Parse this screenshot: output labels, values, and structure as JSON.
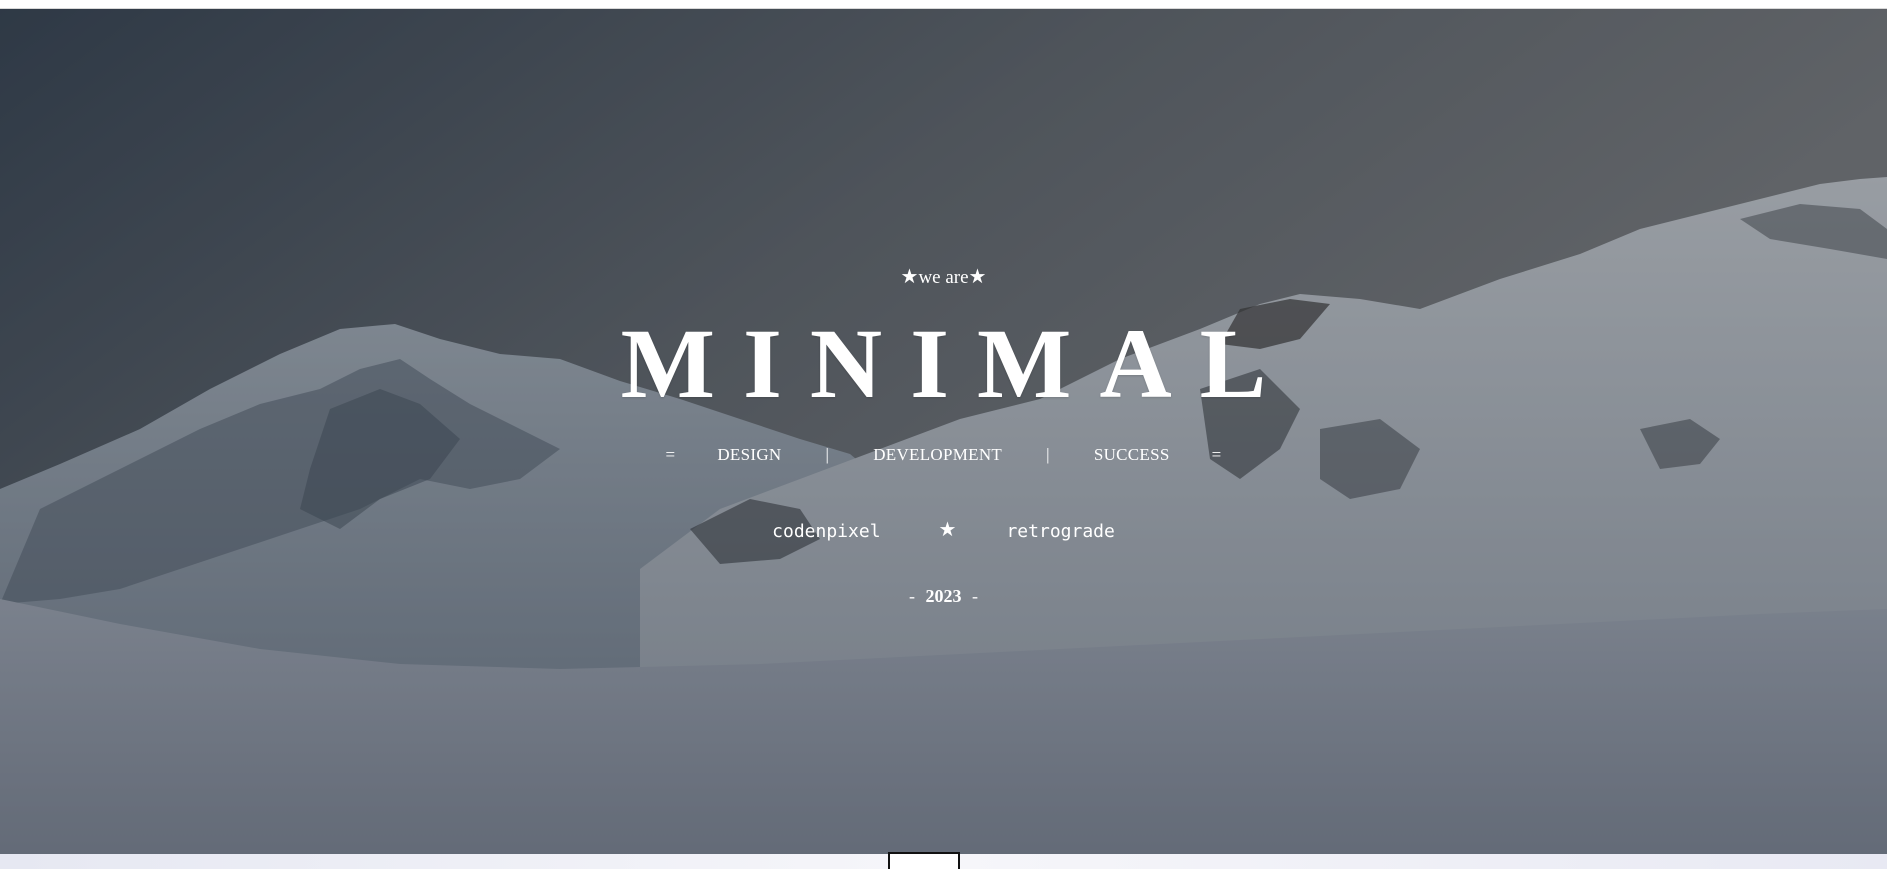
{
  "hero": {
    "tagline_star_left": "★",
    "tagline_text": "we are",
    "tagline_star_right": "★",
    "title": "MINIMAL",
    "services": {
      "sep_start": "=",
      "item1": "DESIGN",
      "sep1": "|",
      "item2": "DEVELOPMENT",
      "sep2": "|",
      "item3": "SUCCESS",
      "sep_end": "="
    },
    "credits": {
      "left": "codenpixel",
      "star": "★",
      "right": "retrograde"
    },
    "year": {
      "dash_left": "-",
      "value": "2023",
      "dash_right": "-"
    }
  },
  "colors": {
    "text": "#ffffff",
    "sky_overlay": "#3d4552"
  },
  "icons": {
    "tagline_star": "star-icon",
    "credit_star": "star-icon",
    "scroll": "scroll-indicator"
  }
}
